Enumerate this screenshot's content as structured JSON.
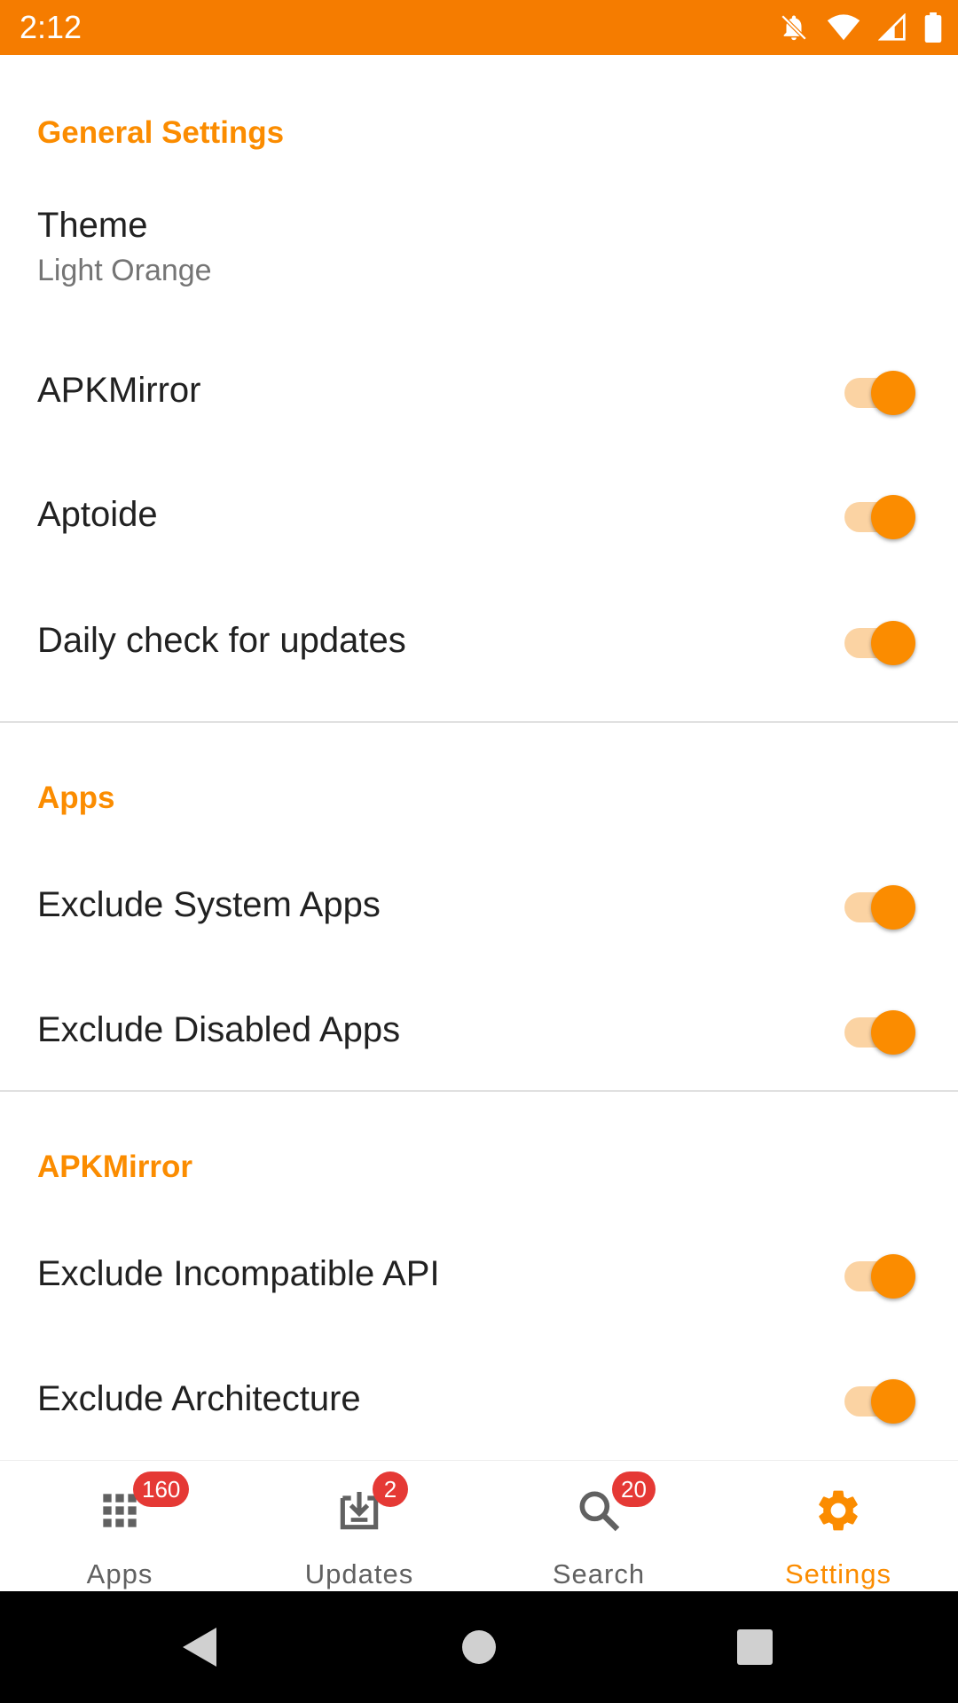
{
  "status_bar": {
    "time": "2:12",
    "icons": [
      "notifications-off-icon",
      "wifi-icon",
      "signal-icon",
      "battery-icon"
    ],
    "background": "#f57c00"
  },
  "accent_color": "#fb8c00",
  "sections": [
    {
      "header": "General Settings",
      "prefs": [
        {
          "title": "Theme",
          "summary": "Light Orange"
        },
        {
          "title": "APKMirror",
          "enabled": true
        },
        {
          "title": "Aptoide",
          "enabled": true
        },
        {
          "title": "Daily check for updates",
          "enabled": true
        }
      ]
    },
    {
      "header": "Apps",
      "prefs": [
        {
          "title": "Exclude System Apps",
          "enabled": true
        },
        {
          "title": "Exclude Disabled Apps",
          "enabled": true
        }
      ]
    },
    {
      "header": "APKMirror",
      "prefs": [
        {
          "title": "Exclude Incompatible API",
          "enabled": true
        },
        {
          "title": "Exclude Architecture",
          "enabled": true
        }
      ]
    }
  ],
  "bottom_nav": [
    {
      "label": "Apps",
      "badge": "160",
      "icon": "apps-grid-icon",
      "active": false
    },
    {
      "label": "Updates",
      "badge": "2",
      "icon": "download-icon",
      "active": false
    },
    {
      "label": "Search",
      "badge": "20",
      "icon": "search-icon",
      "active": false
    },
    {
      "label": "Settings",
      "icon": "gear-icon",
      "active": true
    }
  ],
  "system_nav": [
    "back-icon",
    "home-icon",
    "recents-icon"
  ]
}
